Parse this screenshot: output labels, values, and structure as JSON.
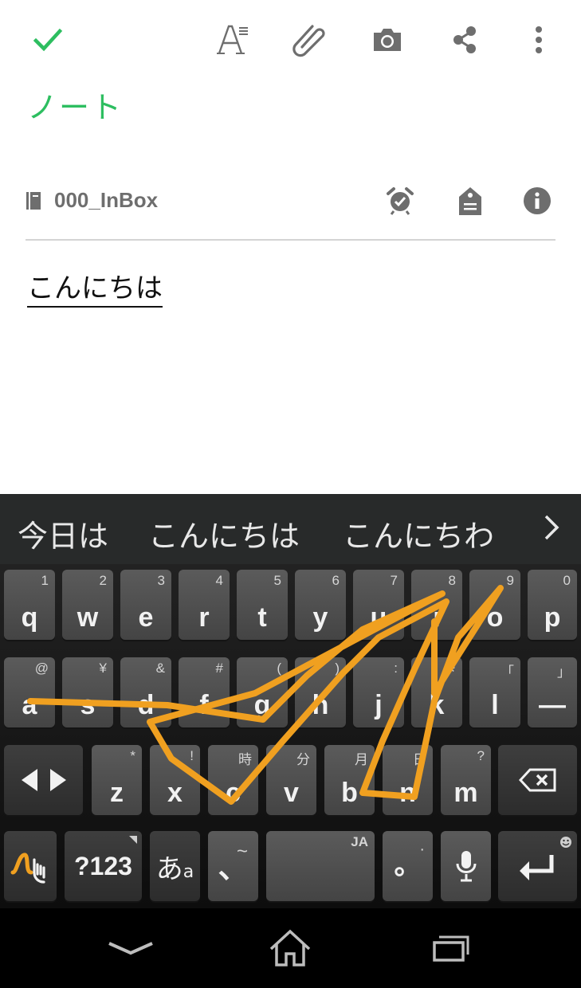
{
  "note": {
    "title": "ノート",
    "notebook": "000_InBox",
    "body": "こんにちは"
  },
  "colors": {
    "accent": "#2dbe60",
    "toolbar_icon": "#6e6e6e",
    "trace": "#f0a020"
  },
  "toolbar": {
    "icons": [
      "check-icon",
      "text-format-icon",
      "attachment-icon",
      "camera-icon",
      "share-icon",
      "more-vert-icon"
    ]
  },
  "keyboard": {
    "suggestions": [
      "今日は",
      "こんにちは",
      "こんにちわ"
    ],
    "row1": [
      {
        "main": "q",
        "sub": "1"
      },
      {
        "main": "w",
        "sub": "2"
      },
      {
        "main": "e",
        "sub": "3"
      },
      {
        "main": "r",
        "sub": "4"
      },
      {
        "main": "t",
        "sub": "5"
      },
      {
        "main": "y",
        "sub": "6"
      },
      {
        "main": "u",
        "sub": "7"
      },
      {
        "main": "i",
        "sub": "8"
      },
      {
        "main": "o",
        "sub": "9"
      },
      {
        "main": "p",
        "sub": "0"
      }
    ],
    "row2": [
      {
        "main": "a",
        "sub": "@"
      },
      {
        "main": "s",
        "sub": "¥"
      },
      {
        "main": "d",
        "sub": "&"
      },
      {
        "main": "f",
        "sub": "#"
      },
      {
        "main": "g",
        "sub": "("
      },
      {
        "main": "h",
        "sub": ")"
      },
      {
        "main": "j",
        "sub": ":"
      },
      {
        "main": "k",
        "sub": "※"
      },
      {
        "main": "l",
        "sub": "「"
      },
      {
        "main": "—",
        "sub": "」"
      }
    ],
    "row3": [
      {
        "main": "z",
        "sub": "*"
      },
      {
        "main": "x",
        "sub": "!"
      },
      {
        "main": "c",
        "sub": "時"
      },
      {
        "main": "v",
        "sub": "分"
      },
      {
        "main": "b",
        "sub": "月"
      },
      {
        "main": "n",
        "sub": "日"
      },
      {
        "main": "m",
        "sub": "?"
      }
    ],
    "symbols_label": "?123",
    "kana_label": "あ",
    "kana_sub": "a",
    "comma_label": "、",
    "comma_sub": "~",
    "space_sub": "JA",
    "period_label": "。",
    "period_sub": "·"
  }
}
